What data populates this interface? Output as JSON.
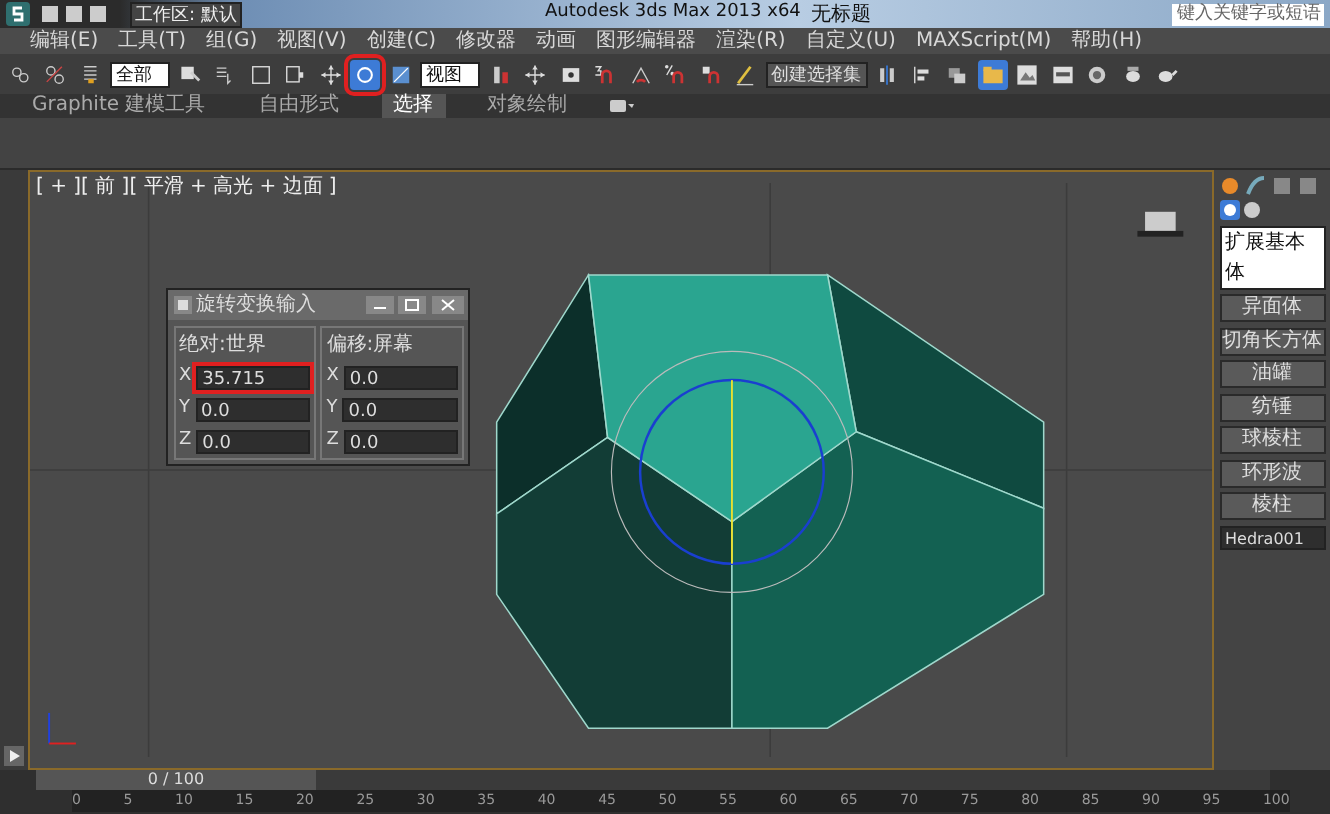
{
  "window": {
    "title": "Autodesk 3ds Max 2013 x64",
    "document": "无标题",
    "workspace": "工作区: 默认",
    "search": {
      "placeholder": "键入关键字或短语"
    }
  },
  "menu": [
    "编辑(E)",
    "工具(T)",
    "组(G)",
    "视图(V)",
    "创建(C)",
    "修改器",
    "动画",
    "图形编辑器",
    "渲染(R)",
    "自定义(U)",
    "MAXScript(M)",
    "帮助(H)"
  ],
  "toolbar": [
    {
      "kind": "link",
      "selected": false
    },
    {
      "kind": "unlink",
      "selected": false
    },
    {
      "kind": "bind",
      "selected": false
    },
    {
      "kind": "dropdown",
      "value": "全部"
    },
    {
      "kind": "select",
      "selected": false
    },
    {
      "kind": "select-list",
      "selected": false
    },
    {
      "kind": "region",
      "selected": false
    },
    {
      "kind": "window",
      "selected": false
    },
    {
      "kind": "move",
      "selected": false
    },
    {
      "kind": "rotate",
      "selected": true,
      "highlight": true
    },
    {
      "kind": "scale",
      "selected": false
    },
    {
      "kind": "dropdown",
      "value": "视图"
    },
    {
      "kind": "pivot",
      "selected": false
    },
    {
      "kind": "move",
      "selected": false
    },
    {
      "kind": "manipulate",
      "selected": false
    },
    {
      "kind": "snap",
      "selected": false
    },
    {
      "kind": "angle-snap",
      "selected": false
    },
    {
      "kind": "percent-snap",
      "selected": false
    },
    {
      "kind": "spinner-snap",
      "selected": false
    },
    {
      "kind": "edit-named",
      "selected": false
    },
    {
      "kind": "field",
      "value": "创建选择集"
    },
    {
      "kind": "mirror",
      "selected": false
    },
    {
      "kind": "align",
      "selected": false
    },
    {
      "kind": "layer",
      "selected": false
    },
    {
      "kind": "graph",
      "selected": true
    },
    {
      "kind": "material",
      "selected": false
    },
    {
      "kind": "render-setup",
      "selected": false
    },
    {
      "kind": "render-frame",
      "selected": false
    },
    {
      "kind": "render",
      "selected": false
    },
    {
      "kind": "teapot",
      "selected": false
    }
  ],
  "ribbon_tabs": [
    {
      "label": "Graphite 建模工具",
      "selected": false
    },
    {
      "label": "自由形式",
      "selected": false
    },
    {
      "label": "选择",
      "selected": true
    },
    {
      "label": "对象绘制",
      "selected": false
    }
  ],
  "viewport": {
    "label": "[ + ][ 前 ][ 平滑 + 高光 + 边面 ]"
  },
  "dialog": {
    "title": "旋转变换输入",
    "groups": [
      {
        "title": "绝对:世界",
        "fields": [
          {
            "axis": "X",
            "value": "35.715",
            "highlight": true
          },
          {
            "axis": "Y",
            "value": "0.0",
            "highlight": false
          },
          {
            "axis": "Z",
            "value": "0.0",
            "highlight": false
          }
        ]
      },
      {
        "title": "偏移:屏幕",
        "fields": [
          {
            "axis": "X",
            "value": "0.0",
            "highlight": false
          },
          {
            "axis": "Y",
            "value": "0.0",
            "highlight": false
          },
          {
            "axis": "Z",
            "value": "0.0",
            "highlight": false
          }
        ]
      }
    ]
  },
  "command_panel": {
    "dropdown": "扩展基本体",
    "buttons": [
      "异面体",
      "切角长方体",
      "油罐",
      "纺锤",
      "球棱柱",
      "环形波",
      "棱柱"
    ],
    "name_field": "Hedra001"
  },
  "timeline": {
    "frame": "0 / 100",
    "ticks": [
      "0",
      "5",
      "10",
      "15",
      "20",
      "25",
      "30",
      "35",
      "40",
      "45",
      "50",
      "55",
      "60",
      "65",
      "70",
      "75",
      "80",
      "85",
      "90",
      "95",
      "100"
    ]
  }
}
